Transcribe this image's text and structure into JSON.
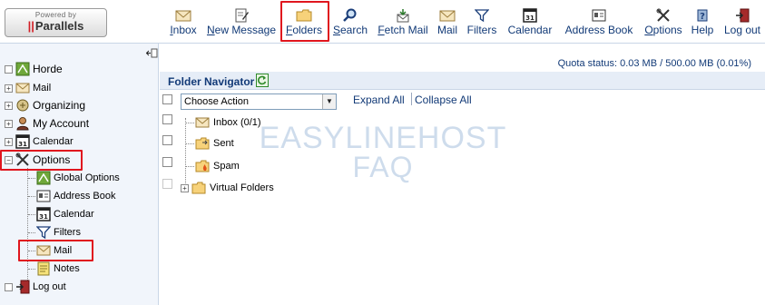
{
  "logo": {
    "powered": "Powered by",
    "name": "Parallels"
  },
  "toolbar": {
    "inbox": "Inbox",
    "new_message": "New Message",
    "folders": "Folders",
    "search": "Search",
    "fetch_mail": "Fetch Mail",
    "mail": "Mail",
    "filters": "Filters",
    "calendar": "Calendar",
    "address_book": "Address Book",
    "options": "Options",
    "help": "Help",
    "logout": "Log out",
    "calendar_icon_text": "31"
  },
  "sidebar": {
    "horde": "Horde",
    "mail": "Mail",
    "organizing": "Organizing",
    "my_account": "My Account",
    "calendar": "Calendar",
    "options": "Options",
    "children": {
      "global_options": "Global Options",
      "address_book": "Address Book",
      "calendar": "Calendar",
      "filters": "Filters",
      "mail": "Mail",
      "notes": "Notes"
    },
    "logout": "Log out"
  },
  "main": {
    "quota": "Quota status: 0.03 MB / 500.00 MB (0.01%)",
    "folder_navigator": "Folder Navigator",
    "choose_action": "Choose Action",
    "expand_all": "Expand All",
    "collapse_all": "Collapse All",
    "folders": [
      "Inbox (0/1)",
      "Sent",
      "Spam",
      "Virtual Folders"
    ]
  },
  "watermark": {
    "line1": "EASYLINEHOST",
    "line2": "FAQ"
  },
  "colors": {
    "highlight": "#e0161e",
    "link": "#123a77",
    "sidebar_bg": "#f1f5fb"
  }
}
